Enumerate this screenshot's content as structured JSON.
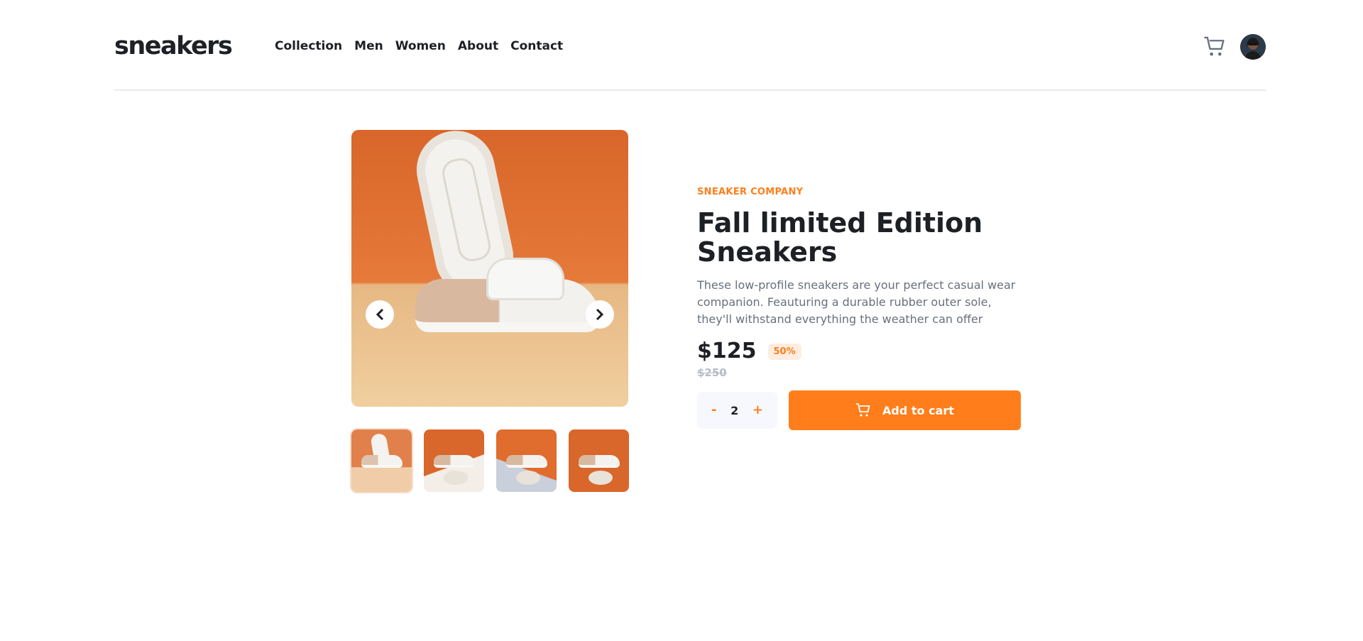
{
  "header": {
    "logo": "sneakers",
    "nav": [
      "Collection",
      "Men",
      "Women",
      "About",
      "Contact"
    ],
    "icons": {
      "cart": "cart-icon",
      "avatar": "user-avatar"
    }
  },
  "gallery": {
    "prev_icon": "chevron-left-icon",
    "next_icon": "chevron-right-icon",
    "thumbnail_count": 4,
    "active_thumbnail": 1
  },
  "product": {
    "company": "SNEAKER COMPANY",
    "title": "Fall limited Edition Sneakers",
    "description": "These low-profile sneakers are your perfect casual wear companion. Feauturing a durable rubber outer sole, they'll withstand everything the weather can offer",
    "price": "$125",
    "discount": "50%",
    "original_price": "$250"
  },
  "cart_controls": {
    "decrement_label": "-",
    "quantity": "2",
    "increment_label": "+",
    "add_to_cart_label": "Add to cart"
  },
  "colors": {
    "accent": "#ff7e1b",
    "accent_pale": "#ffede0",
    "text_dark": "#1d2025",
    "text_muted": "#68707d",
    "text_light": "#b6bcc8"
  }
}
